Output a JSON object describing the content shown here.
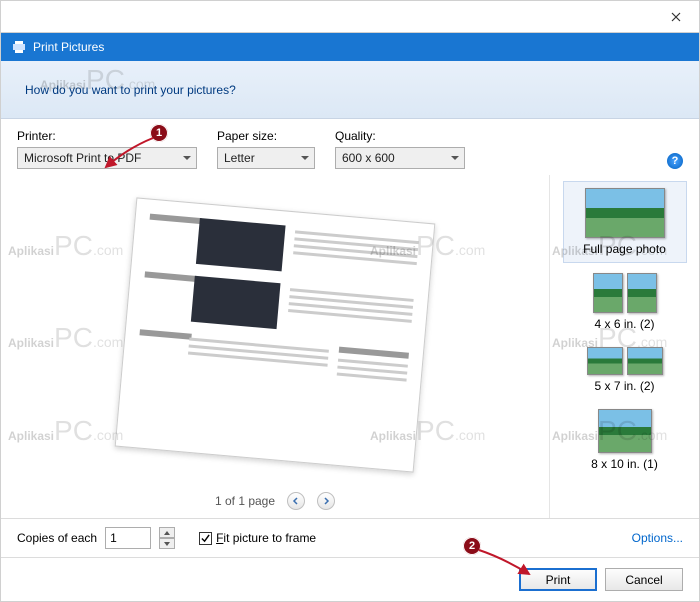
{
  "window": {
    "title": "Print Pictures"
  },
  "banner": {
    "heading": "How do you want to print your pictures?"
  },
  "fields": {
    "printer": {
      "label": "Printer:",
      "value": "Microsoft Print to PDF"
    },
    "paper": {
      "label": "Paper size:",
      "value": "Letter"
    },
    "quality": {
      "label": "Quality:",
      "value": "600 x 600"
    }
  },
  "pager": {
    "text": "1 of 1 page"
  },
  "layouts": {
    "full": "Full page photo",
    "l46": "4 x 6 in. (2)",
    "l57": "5 x 7 in. (2)",
    "l810": "8 x 10 in. (1)"
  },
  "bottom": {
    "copies_label": "Copies of each",
    "copies_value": "1",
    "fit_label": "Fit picture to frame",
    "options": "Options..."
  },
  "footer": {
    "print": "Print",
    "cancel": "Cancel"
  },
  "annotations": {
    "n1": "1",
    "n2": "2"
  },
  "watermark": "AplikasiPC"
}
